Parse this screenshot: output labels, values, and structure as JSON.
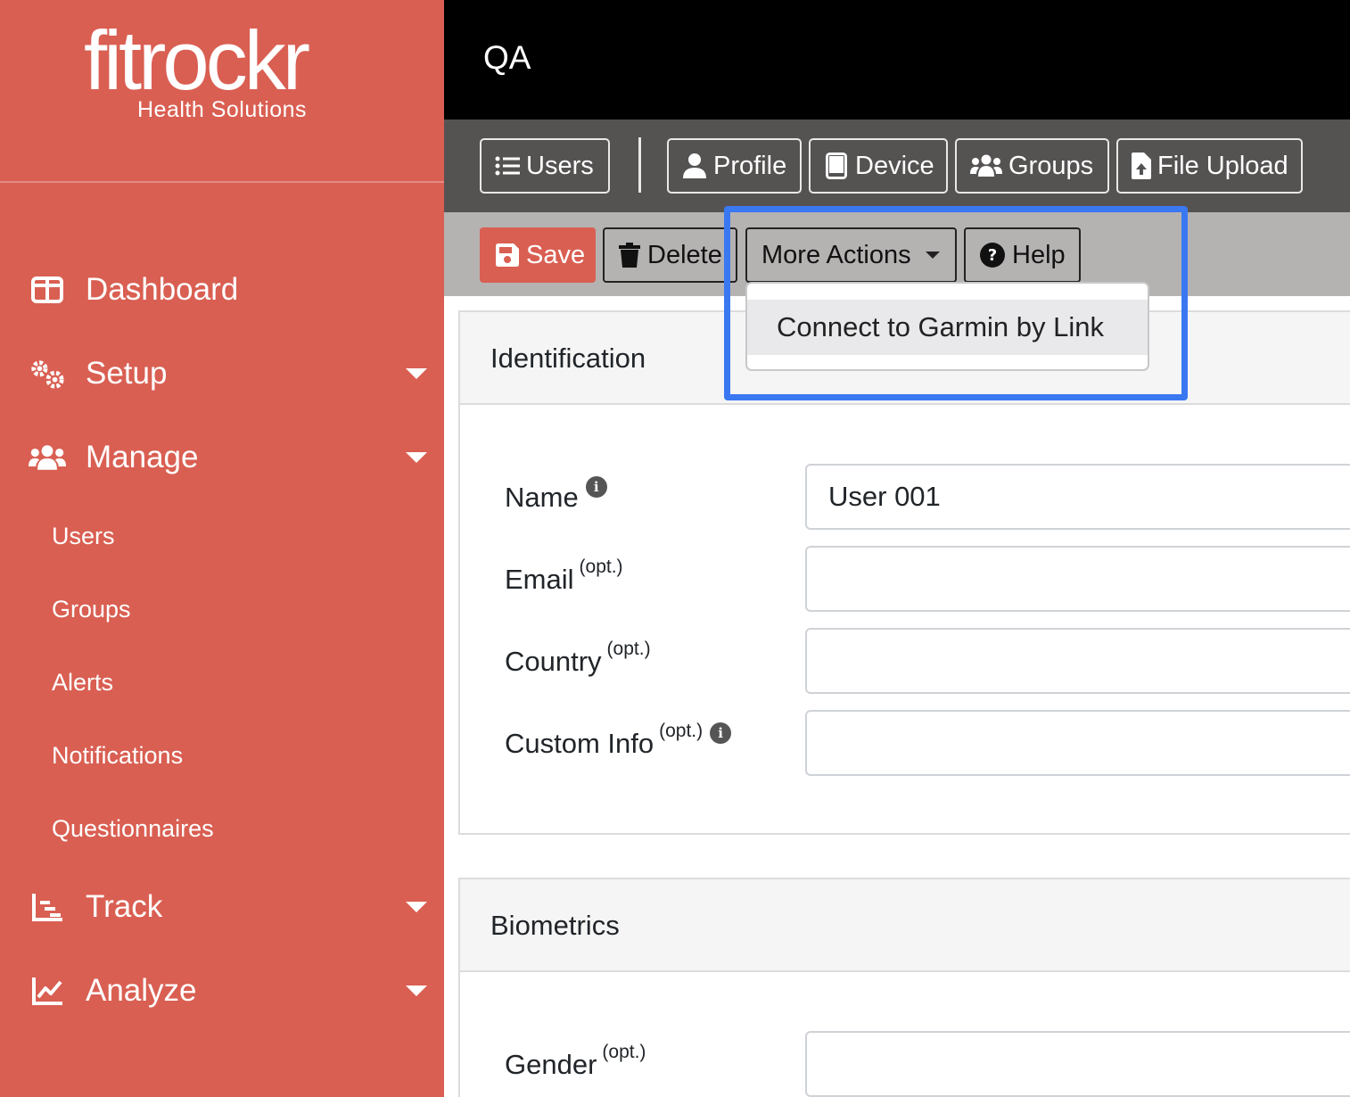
{
  "brand": {
    "name": "fitrockr",
    "tagline": "Health Solutions"
  },
  "sidebar": {
    "items": [
      {
        "label": "Dashboard",
        "icon": "dashboard-icon",
        "has_caret": false
      },
      {
        "label": "Setup",
        "icon": "gears-icon",
        "has_caret": true
      },
      {
        "label": "Manage",
        "icon": "users-icon",
        "has_caret": true
      },
      {
        "label": "Track",
        "icon": "track-icon",
        "has_caret": true
      },
      {
        "label": "Analyze",
        "icon": "chart-line-icon",
        "has_caret": true
      }
    ],
    "manage_subitems": [
      "Users",
      "Groups",
      "Alerts",
      "Notifications",
      "Questionnaires"
    ]
  },
  "header": {
    "title": "QA"
  },
  "tabs": [
    {
      "label": "Users",
      "icon": "list-icon"
    },
    {
      "label": "Profile",
      "icon": "user-icon"
    },
    {
      "label": "Device",
      "icon": "tablet-icon"
    },
    {
      "label": "Groups",
      "icon": "users-icon"
    },
    {
      "label": "File Upload",
      "icon": "file-upload-icon"
    }
  ],
  "actions": {
    "save": "Save",
    "delete": "Delete",
    "more_actions": "More Actions",
    "help": "Help"
  },
  "dropdown": {
    "items": [
      "Connect to Garmin by Link"
    ]
  },
  "identification": {
    "title": "Identification",
    "fields": [
      {
        "label": "Name",
        "optional": "",
        "info": true,
        "value": "User 001"
      },
      {
        "label": "Email",
        "optional": "(opt.)",
        "info": false,
        "value": ""
      },
      {
        "label": "Country",
        "optional": "(opt.)",
        "info": false,
        "value": ""
      },
      {
        "label": "Custom Info",
        "optional": "(opt.)",
        "info": true,
        "value": ""
      }
    ]
  },
  "biometrics": {
    "title": "Biometrics",
    "fields": [
      {
        "label": "Gender",
        "optional": "(opt.)",
        "value": ""
      }
    ]
  },
  "colors": {
    "brand": "#d95f52",
    "highlight": "#3a78f2",
    "topbar": "#000000",
    "tabbar": "#555252",
    "actionbar": "#b5b2b2"
  }
}
